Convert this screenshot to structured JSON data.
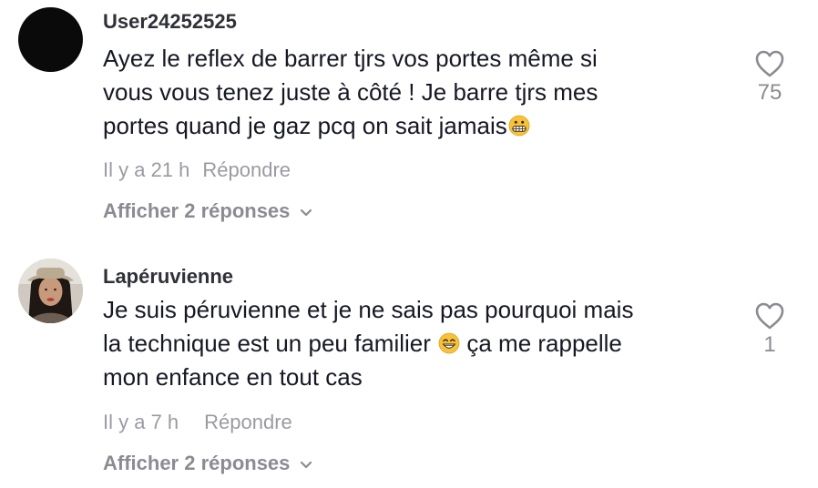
{
  "comments": [
    {
      "username": "User24252525",
      "text_lines": [
        "Ayez le reflex de barrer tjrs vos portes même si",
        "vous vous tenez juste à côté ! Je barre tjrs mes",
        "portes quand je gaz pcq on sait jamais"
      ],
      "emoji": "grimacing-face",
      "time": "Il y a 21 h",
      "reply_label": "Répondre",
      "view_replies_label": "Afficher 2 réponses",
      "likes": "75"
    },
    {
      "username": "Lapéruvienne",
      "text_lines": [
        "Je suis péruvienne et je ne sais pas pourquoi mais",
        "la technique est un peu familier",
        " ça me rappelle",
        "mon enfance en tout cas"
      ],
      "emoji": "grinning-face-smiling-eyes",
      "time": "Il y a 7 h",
      "reply_label": "Répondre",
      "view_replies_label": "Afficher 2 réponses",
      "likes": "1"
    }
  ],
  "colors": {
    "text": "#161823",
    "secondary": "#9a9ba2",
    "emoji_yellow": "#f7c23a"
  }
}
